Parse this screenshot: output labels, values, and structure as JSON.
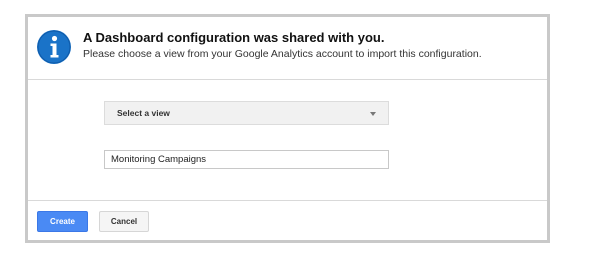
{
  "dialog": {
    "title": "A Dashboard configuration was shared with you.",
    "message": "Please choose a view from your Google Analytics account to import this configuration.",
    "icon": "info-icon",
    "select_view": {
      "label": "Select a view",
      "icon": "chevron-down-icon"
    },
    "name_input": {
      "value": "Monitoring Campaigns"
    },
    "buttons": {
      "create_label": "Create",
      "cancel_label": "Cancel"
    }
  },
  "colors": {
    "primary_button": "#4a8af4",
    "info_icon": "#1a73c8",
    "dialog_border": "#c9c9c9"
  }
}
